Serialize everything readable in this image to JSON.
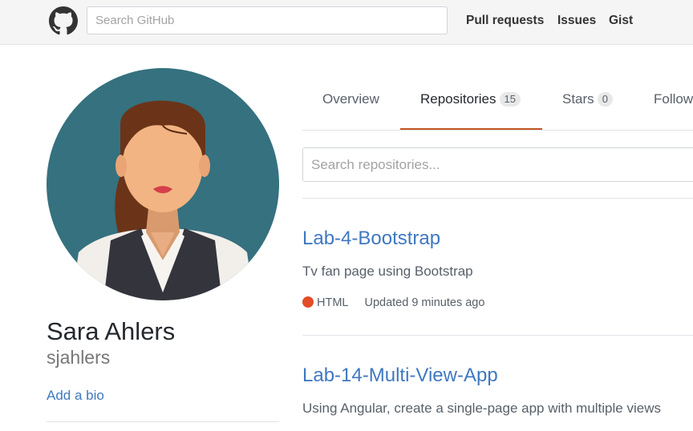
{
  "header": {
    "search_placeholder": "Search GitHub",
    "nav": [
      "Pull requests",
      "Issues",
      "Gist"
    ]
  },
  "profile": {
    "name": "Sara Ahlers",
    "username": "sjahlers",
    "bio_link": "Add a bio"
  },
  "tabs": [
    {
      "label": "Overview",
      "count": null
    },
    {
      "label": "Repositories",
      "count": "15"
    },
    {
      "label": "Stars",
      "count": "0"
    },
    {
      "label": "Follow",
      "count": null
    }
  ],
  "repo_search_placeholder": "Search repositories...",
  "repos": [
    {
      "title": "Lab-4-Bootstrap",
      "description": "Tv fan page using Bootstrap",
      "language": "HTML",
      "language_color": "#e34c26",
      "updated": "Updated 9 minutes ago"
    },
    {
      "title": "Lab-14-Multi-View-App",
      "description": "Using Angular, create a single-page app with multiple views"
    }
  ],
  "colors": {
    "link": "#4078c0",
    "tab_underline": "#c25422",
    "avatar_bg": "#35717f"
  },
  "icons": [
    "github-logo-icon",
    "avatar-illustration"
  ]
}
